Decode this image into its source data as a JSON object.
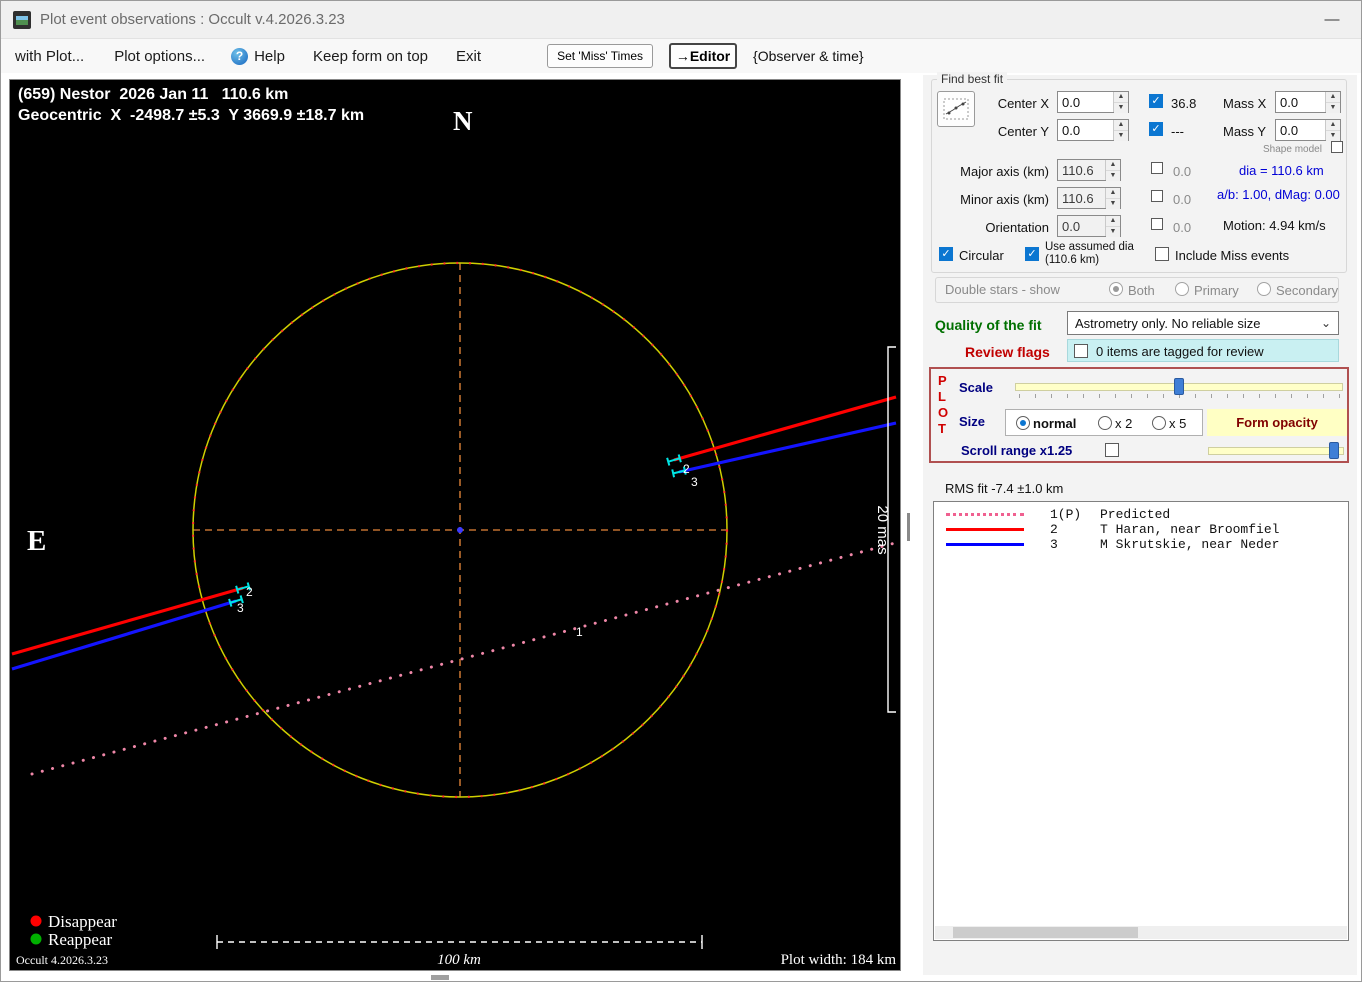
{
  "window": {
    "title": "Plot event observations : Occult v.4.2026.3.23"
  },
  "icons": {
    "check": "✓",
    "up": "▲",
    "down": "▼",
    "dropdown": "⌄",
    "help": "?",
    "minimize": "—"
  },
  "menu": {
    "with_plot": "with Plot...",
    "plot_options": "Plot options...",
    "help": "Help",
    "keep_on_top": "Keep form on top",
    "exit": "Exit",
    "set_miss_times": "Set 'Miss' Times",
    "editor": "→Editor",
    "observer_time": "{Observer & time}"
  },
  "plot": {
    "header_line1": "(659) Nestor  2026 Jan 11   110.6 km",
    "header_line2": "Geocentric  X  -2498.7 ±5.3  Y 3669.9 ±18.7 km",
    "north": "N",
    "east": "E",
    "mas_scale": "20 mas",
    "station1_label": "1",
    "chord2_label": "2",
    "chord3_label": "3",
    "legend_disappear": "Disappear",
    "legend_reappear": "Reappear",
    "version": "Occult 4.2026.3.23",
    "scale_bar": "100 km",
    "plot_width": "Plot width: 184 km"
  },
  "fit": {
    "group_title": "Find best fit",
    "center_x_label": "Center X",
    "center_x_value": "0.0",
    "center_x_rms": "36.8",
    "center_y_label": "Center Y",
    "center_y_value": "0.0",
    "center_y_rms": "---",
    "mass_x_label": "Mass X",
    "mass_x_value": "0.0",
    "mass_y_label": "Mass Y",
    "mass_y_value": "0.0",
    "shape_model": "Shape model",
    "major_label": "Major axis (km)",
    "major_value": "110.6",
    "major_rms": "0.0",
    "minor_label": "Minor axis (km)",
    "minor_value": "110.6",
    "minor_rms": "0.0",
    "orientation_label": "Orientation",
    "orientation_value": "0.0",
    "orientation_rms": "0.0",
    "dia_info": "dia = 110.6 km",
    "ab_info": "a/b: 1.00, dMag: 0.00",
    "motion_info": "Motion: 4.94 km/s",
    "circular": "Circular",
    "use_assumed": "Use assumed dia (110.6 km)",
    "include_miss": "Include Miss events"
  },
  "double_stars": {
    "label": "Double stars - show",
    "both": "Both",
    "primary": "Primary",
    "secondary": "Secondary"
  },
  "quality": {
    "label": "Quality of the fit",
    "value": "Astrometry only. No reliable size"
  },
  "review": {
    "label": "Review flags",
    "status": "0 items are tagged for review"
  },
  "plot_controls": {
    "letters": [
      "P",
      "L",
      "O",
      "T"
    ],
    "scale_label": "Scale",
    "size_label": "Size",
    "size_normal": "normal",
    "size_x2": "x 2",
    "size_x5": "x 5",
    "form_opacity": "Form opacity",
    "scroll_range": "Scroll range x1.25"
  },
  "rms_fit": "RMS fit -7.4 ±1.0 km",
  "observers": [
    {
      "num": "1(P)",
      "name": "Predicted"
    },
    {
      "num": "2",
      "name": "T Haran, near Broomfiel"
    },
    {
      "num": "3",
      "name": "M Skrutskie, near Neder"
    }
  ]
}
